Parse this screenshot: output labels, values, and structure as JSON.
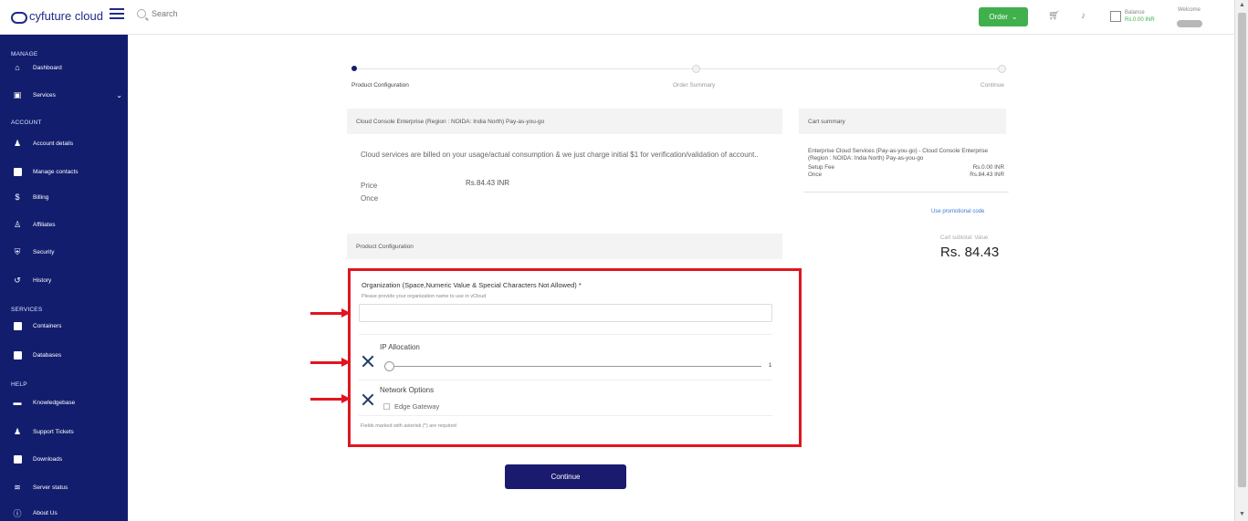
{
  "brand": {
    "name": "cyfuture cloud"
  },
  "topbar": {
    "search_placeholder": "Search",
    "order_label": "Order",
    "balance_label": "Balance",
    "balance_value": "Rs.0.00 INR",
    "welcome_label": "Welcome"
  },
  "sidebar": {
    "manage": {
      "title": "MANAGE",
      "items": [
        {
          "label": "Dashboard",
          "icon": "home-icon"
        },
        {
          "label": "Services",
          "icon": "services-icon"
        }
      ]
    },
    "account": {
      "title": "ACCOUNT",
      "items": [
        {
          "label": "Account details",
          "icon": "user-icon"
        },
        {
          "label": "Manage contacts",
          "icon": "contacts-icon"
        },
        {
          "label": "Billing",
          "icon": "dollar-icon"
        },
        {
          "label": "Affiliates",
          "icon": "affiliates-icon"
        },
        {
          "label": "Security",
          "icon": "shield-icon"
        },
        {
          "label": "History",
          "icon": "history-icon"
        }
      ]
    },
    "services": {
      "title": "SERVICES",
      "items": [
        {
          "label": "Containers",
          "icon": "container-icon"
        },
        {
          "label": "Databases",
          "icon": "database-icon"
        }
      ]
    },
    "help": {
      "title": "HELP",
      "items": [
        {
          "label": "Knowledgebase",
          "icon": "book-icon"
        },
        {
          "label": "Support Tickets",
          "icon": "support-icon"
        },
        {
          "label": "Downloads",
          "icon": "download-icon"
        },
        {
          "label": "Server status",
          "icon": "wifi-icon"
        },
        {
          "label": "About Us",
          "icon": "info-icon"
        }
      ]
    }
  },
  "stepper": {
    "steps": [
      "Product Configuration",
      "Order Summary",
      "Continue"
    ],
    "active_index": 0
  },
  "product": {
    "header": "Cloud Console Enterprise (Region : NOIDA: India North) Pay-as-you-go",
    "note": "Cloud services are billed on your usage/actual consumption & we just charge initial $1 for verification/validation of account..",
    "price_label": "Price",
    "price_value": "Rs.84.43 INR",
    "once_label": "Once"
  },
  "config": {
    "header": "Product Configuration",
    "org_label": "Organization (Space,Numeric Value & Special Characters Not Allowed) *",
    "org_hint": "Please provide your organization name to use in vCloud",
    "org_value": "",
    "ip_label": "IP Allocation",
    "ip_value": "1",
    "ip_level_fraction": 0,
    "network_label": "Network Options",
    "edge_label": "Edge Gateway",
    "edge_checked": false,
    "required_note": "Fields marked with asterisk (*) are required"
  },
  "cart": {
    "header": "Cart summary",
    "description": "Enterprise Cloud Services (Pay-as-you-go) - Cloud Console Enterprise (Region : NOIDA: India North) Pay-as-you-go",
    "setup_label": "Setup Fee",
    "setup_value": "Rs.0.00 INR",
    "once_label": "Once",
    "once_value": "Rs.84.43 INR",
    "promo_link": "Use promotional code",
    "total_label": "Cart subtotal: Value",
    "total_value": "Rs. 84.43"
  },
  "actions": {
    "continue_label": "Continue"
  },
  "colors": {
    "sidebar": "#121d6e",
    "primary": "#1a1a6e",
    "order": "#3fb04b",
    "highlight": "#e0161f"
  }
}
